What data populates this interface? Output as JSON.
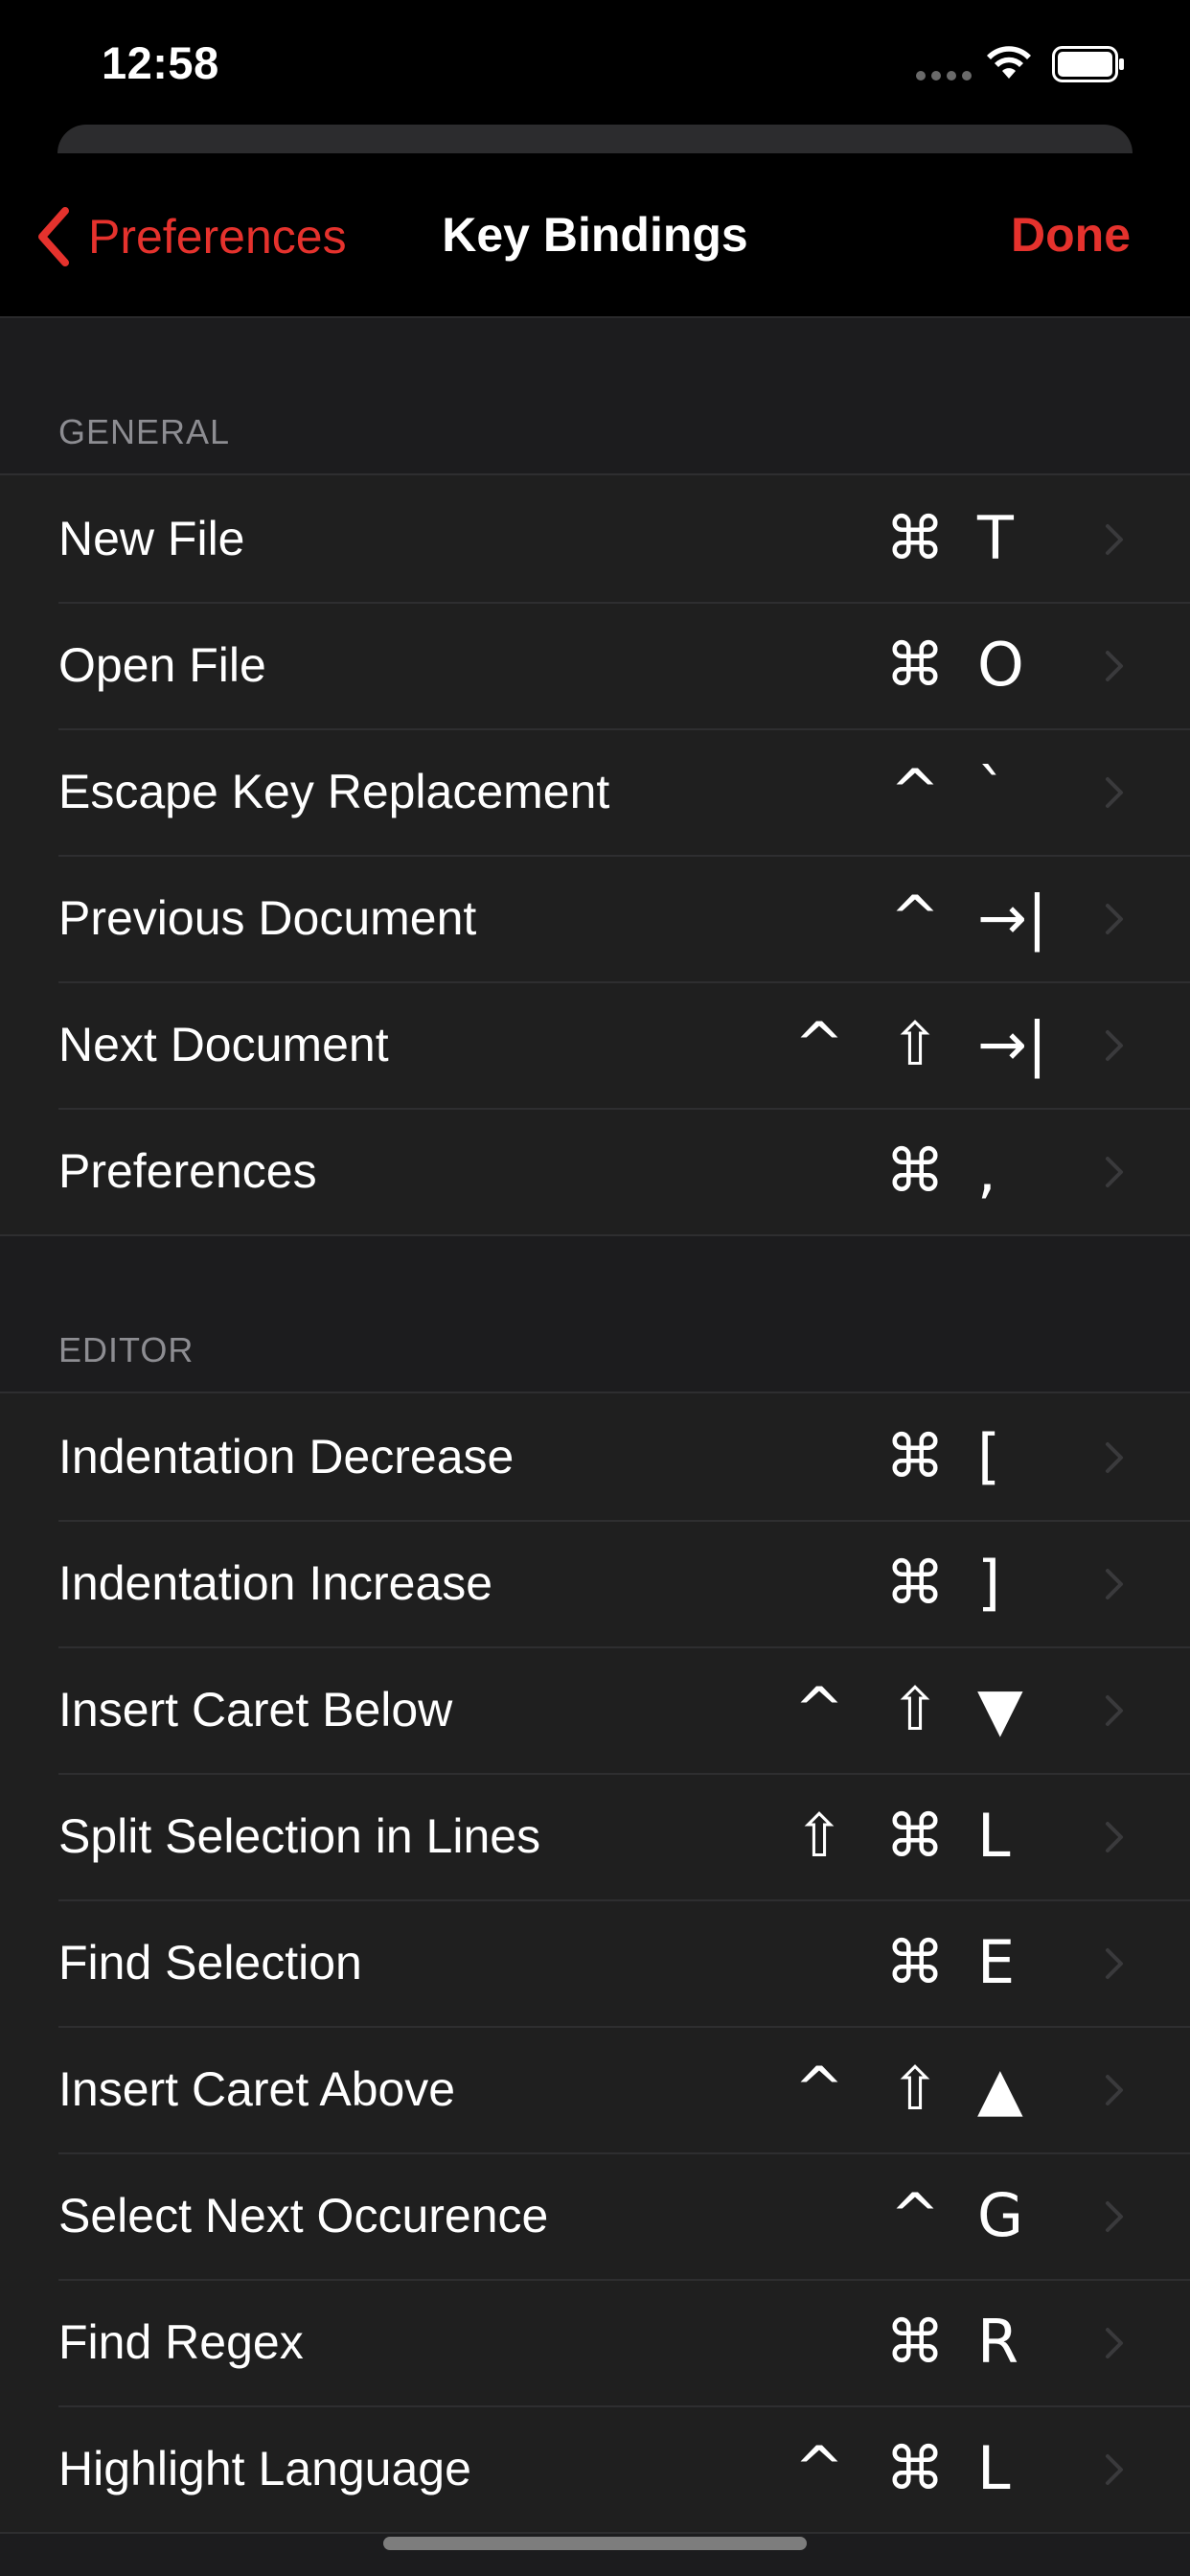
{
  "status_bar": {
    "time": "12:58"
  },
  "nav": {
    "back_label": "Preferences",
    "title": "Key Bindings",
    "done_label": "Done",
    "accent_color": "#e5322d"
  },
  "sections": [
    {
      "header": "GENERAL",
      "rows": [
        {
          "label": "New File",
          "keys": [
            "⌘",
            "T"
          ]
        },
        {
          "label": "Open File",
          "keys": [
            "⌘",
            "O"
          ]
        },
        {
          "label": "Escape Key Replacement",
          "keys": [
            "^",
            "`"
          ]
        },
        {
          "label": "Previous Document",
          "keys": [
            "^",
            "→|"
          ]
        },
        {
          "label": "Next Document",
          "keys": [
            "^",
            "⇧",
            "→|"
          ]
        },
        {
          "label": "Preferences",
          "keys": [
            "⌘",
            ","
          ]
        }
      ]
    },
    {
      "header": "EDITOR",
      "rows": [
        {
          "label": "Indentation Decrease",
          "keys": [
            "⌘",
            "["
          ]
        },
        {
          "label": "Indentation Increase",
          "keys": [
            "⌘",
            "]"
          ]
        },
        {
          "label": "Insert Caret Below",
          "keys": [
            "^",
            "⇧",
            "▼"
          ]
        },
        {
          "label": "Split Selection in Lines",
          "keys": [
            "⇧",
            "⌘",
            "L"
          ]
        },
        {
          "label": "Find Selection",
          "keys": [
            "⌘",
            "E"
          ]
        },
        {
          "label": "Insert Caret Above",
          "keys": [
            "^",
            "⇧",
            "▲"
          ]
        },
        {
          "label": "Select Next Occurence",
          "keys": [
            "^",
            "G"
          ]
        },
        {
          "label": "Find Regex",
          "keys": [
            "⌘",
            "R"
          ]
        },
        {
          "label": "Highlight Language",
          "keys": [
            "^",
            "⌘",
            "L"
          ]
        }
      ]
    }
  ]
}
